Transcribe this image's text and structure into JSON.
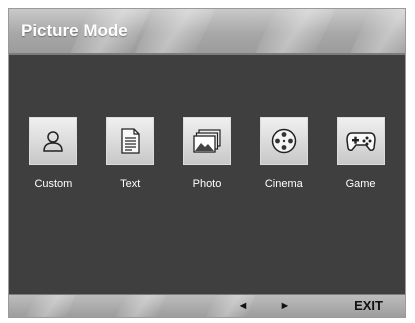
{
  "header": {
    "title": "Picture Mode"
  },
  "modes": [
    {
      "label": "Custom",
      "icon": "person-icon"
    },
    {
      "label": "Text",
      "icon": "document-icon"
    },
    {
      "label": "Photo",
      "icon": "photo-icon"
    },
    {
      "label": "Cinema",
      "icon": "film-reel-icon"
    },
    {
      "label": "Game",
      "icon": "gamepad-icon"
    }
  ],
  "footer": {
    "prev_label": "◄",
    "next_label": "►",
    "exit_label": "EXIT"
  }
}
